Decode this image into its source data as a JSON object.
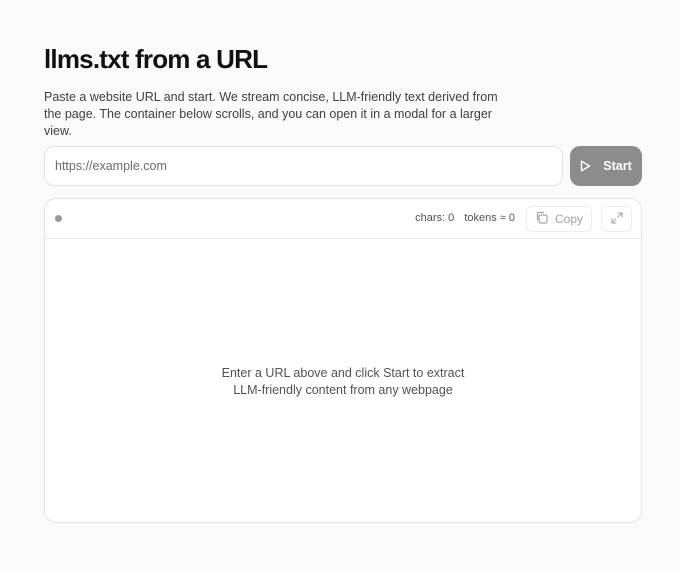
{
  "header": {
    "title": "llms.txt from a URL",
    "description": "Paste a website URL and start. We stream concise, LLM-friendly text derived from the page. The container below scrolls, and you can open it in a modal for a larger view."
  },
  "form": {
    "url_placeholder": "https://example.com",
    "url_value": "",
    "start_label": "Start",
    "start_icon": "play-icon"
  },
  "output": {
    "status": "idle",
    "chars_label": "chars: 0",
    "tokens_label": "tokens ≈ 0",
    "copy_label": "Copy",
    "copy_icon": "copy-icon",
    "expand_icon": "expand-icon",
    "empty_line1": "Enter a URL above and click Start to extract",
    "empty_line2": "LLM-friendly content from any webpage"
  },
  "colors": {
    "start_button": "#8c8c8c",
    "status_dot": "#9a9a9a",
    "background": "#fafafa"
  }
}
